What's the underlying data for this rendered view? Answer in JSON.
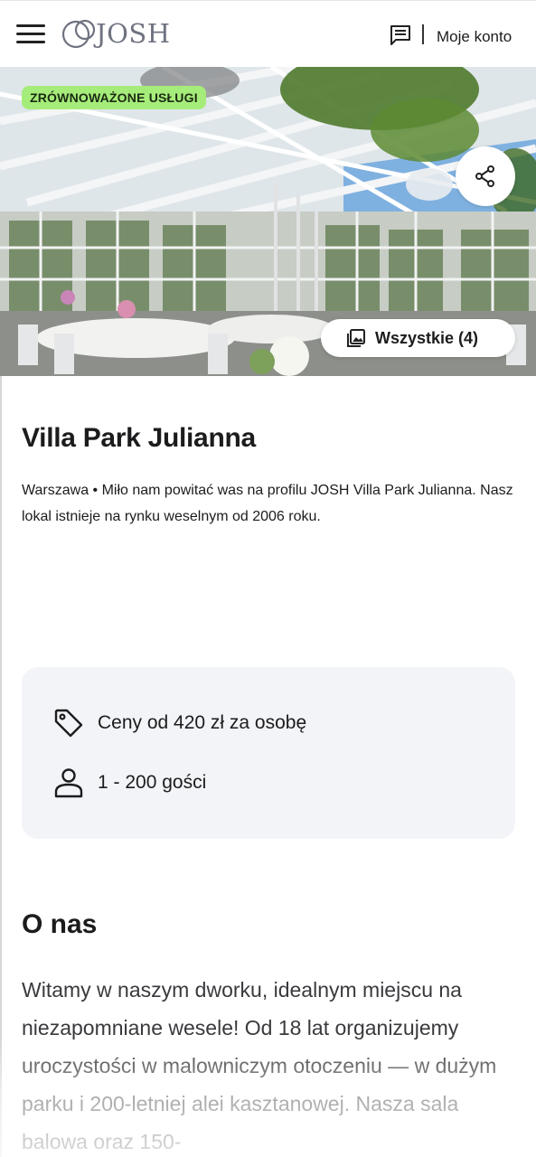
{
  "header": {
    "logo_text": "JOSH",
    "account_label": "Moje konto"
  },
  "hero": {
    "badge": "ZRÓWNOWAŻONE USŁUGI",
    "gallery_label": "Wszystkie (4)"
  },
  "venue": {
    "name": "Villa Park Julianna",
    "description": "Warszawa • Miło nam powitać was na profilu JOSH Villa Park Julianna. Nasz lokal istnieje na rynku weselnym od 2006 roku."
  },
  "info": {
    "price": "Ceny od 420 zł za osobę",
    "guests": "1 - 200 gości"
  },
  "about": {
    "heading": "O nas",
    "text": "Witamy w naszym dworku, idealnym miejscu na niezapomniane wesele! Od 18 lat organizujemy uroczystości w malowniczym otoczeniu — w dużym parku i 200-letniej alei kasztanowej. Nasza sala balowa oraz 150-"
  },
  "colors": {
    "badge_bg": "#a6ec7a",
    "card_bg": "#f3f4f8"
  }
}
